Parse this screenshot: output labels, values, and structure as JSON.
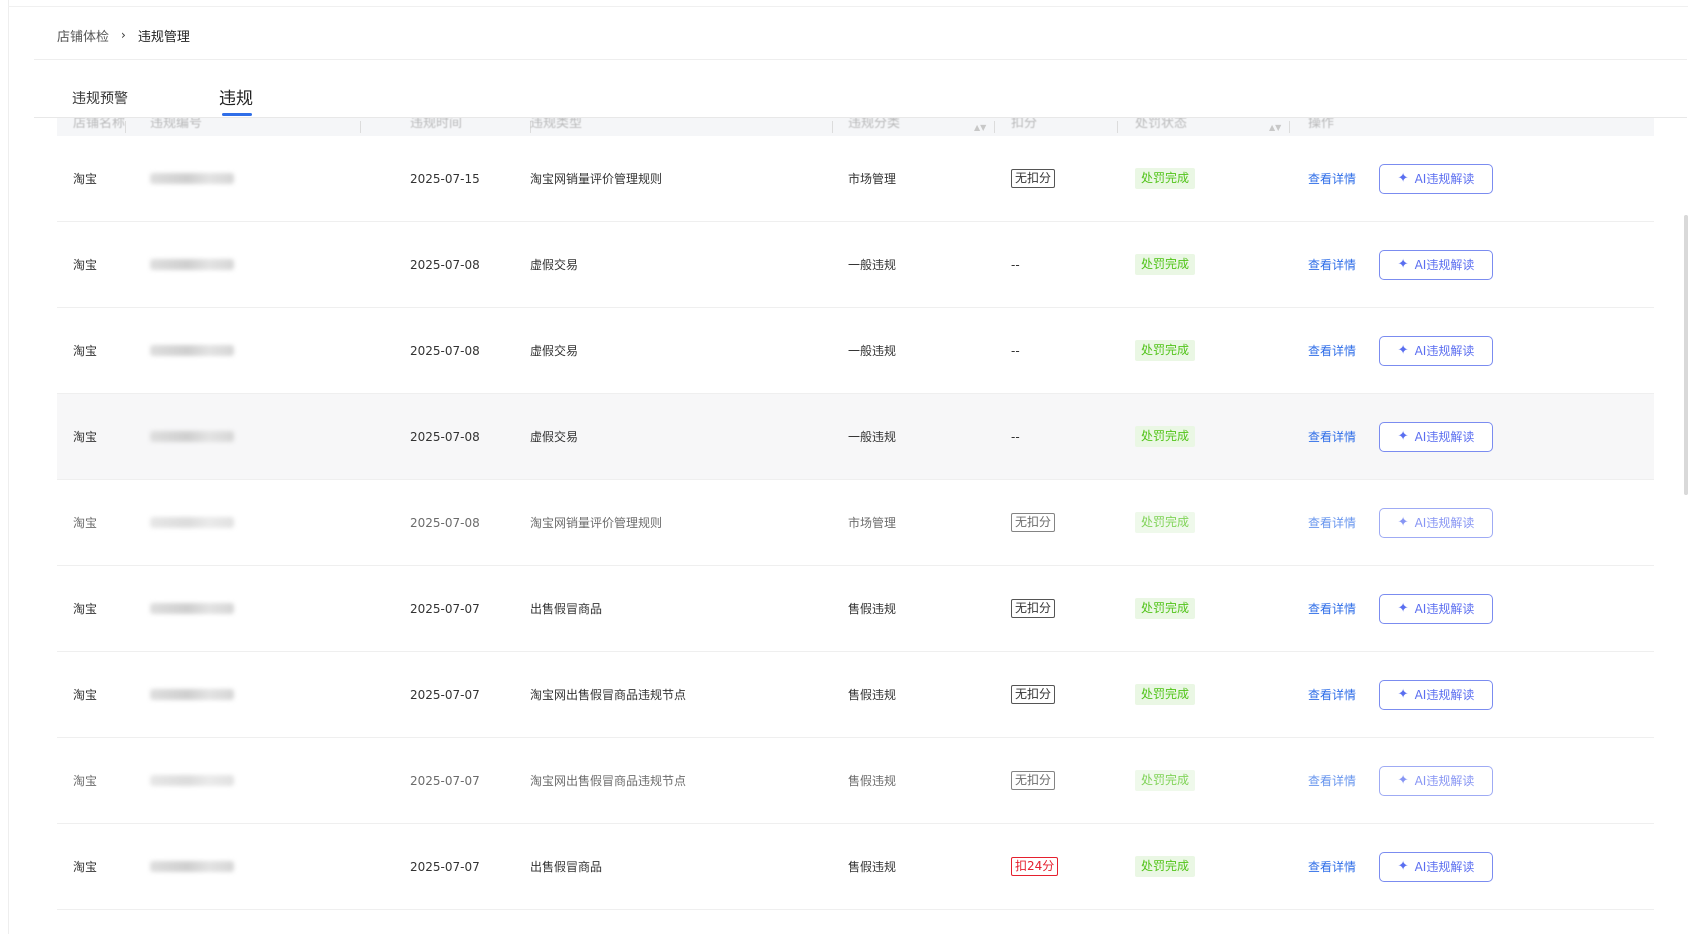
{
  "breadcrumb": {
    "parent": "店铺体检",
    "separator": "›",
    "current": "违规管理"
  },
  "tabs": [
    {
      "label": "违规预警",
      "active": false
    },
    {
      "label": "违规",
      "active": true
    }
  ],
  "table": {
    "headers": [
      "店铺名称",
      "违规编号",
      "违规时间",
      "违规类型",
      "违规分类",
      "扣分",
      "处罚状态",
      "操作"
    ],
    "rows": [
      {
        "platform": "淘宝",
        "date": "2025-07-15",
        "type": "淘宝网销量评价管理规则",
        "category": "市场管理",
        "deduct": "无扣分",
        "deduct_style": "box",
        "status": "处罚完成",
        "detail": "查看详情",
        "ai": "AI违规解读"
      },
      {
        "platform": "淘宝",
        "date": "2025-07-08",
        "type": "虚假交易",
        "category": "一般违规",
        "deduct": "--",
        "deduct_style": "plain",
        "status": "处罚完成",
        "detail": "查看详情",
        "ai": "AI违规解读"
      },
      {
        "platform": "淘宝",
        "date": "2025-07-08",
        "type": "虚假交易",
        "category": "一般违规",
        "deduct": "--",
        "deduct_style": "plain",
        "status": "处罚完成",
        "detail": "查看详情",
        "ai": "AI违规解读"
      },
      {
        "platform": "淘宝",
        "date": "2025-07-08",
        "type": "虚假交易",
        "category": "一般违规",
        "deduct": "--",
        "deduct_style": "plain",
        "status": "处罚完成",
        "detail": "查看详情",
        "ai": "AI违规解读",
        "highlight": true
      },
      {
        "platform": "淘宝",
        "date": "2025-07-08",
        "type": "淘宝网销量评价管理规则",
        "category": "市场管理",
        "deduct": "无扣分",
        "deduct_style": "box",
        "status": "处罚完成",
        "detail": "查看详情",
        "ai": "AI违规解读",
        "dim": true
      },
      {
        "platform": "淘宝",
        "date": "2025-07-07",
        "type": "出售假冒商品",
        "category": "售假违规",
        "deduct": "无扣分",
        "deduct_style": "box",
        "status": "处罚完成",
        "detail": "查看详情",
        "ai": "AI违规解读"
      },
      {
        "platform": "淘宝",
        "date": "2025-07-07",
        "type": "淘宝网出售假冒商品违规节点",
        "category": "售假违规",
        "deduct": "无扣分",
        "deduct_style": "box",
        "status": "处罚完成",
        "detail": "查看详情",
        "ai": "AI违规解读"
      },
      {
        "platform": "淘宝",
        "date": "2025-07-07",
        "type": "淘宝网出售假冒商品违规节点",
        "category": "售假违规",
        "deduct": "无扣分",
        "deduct_style": "box",
        "status": "处罚完成",
        "detail": "查看详情",
        "ai": "AI违规解读",
        "dim": true
      },
      {
        "platform": "淘宝",
        "date": "2025-07-07",
        "type": "出售假冒商品",
        "category": "售假违规",
        "deduct": "扣24分",
        "deduct_style": "red",
        "status": "处罚完成",
        "detail": "查看详情",
        "ai": "AI违规解读"
      }
    ]
  },
  "icons": {
    "ai_button": "sparkle-icon",
    "breadcrumb_separator": "chevron-right-icon",
    "sort": "sort-icon"
  },
  "colors": {
    "accent": "#2f6ee8",
    "success": "#52c41a",
    "success_bg": "#eaf7e4",
    "danger": "#e5202e",
    "ai_border": "#7b8cf0"
  }
}
